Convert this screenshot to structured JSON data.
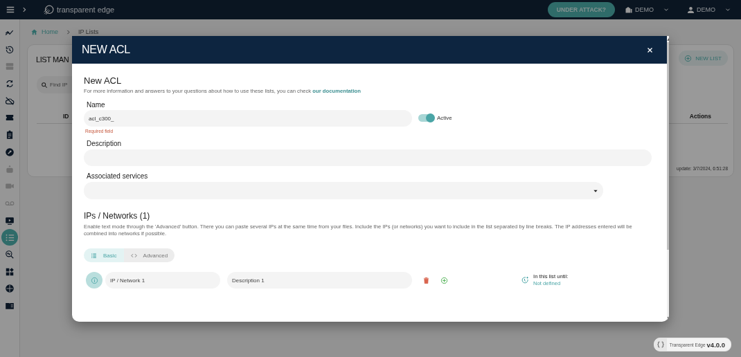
{
  "topbar": {
    "logo": "transparent edge",
    "attack_button": "UNDER ATTACK?",
    "company_menu": "DEMO",
    "user_menu": "DEMO"
  },
  "sidebar": {
    "items": [
      {
        "selected": false,
        "disabled": false
      },
      {
        "selected": false,
        "disabled": false
      },
      {
        "selected": false,
        "disabled": true
      },
      {
        "selected": false,
        "disabled": false
      },
      {
        "selected": false,
        "disabled": false
      },
      {
        "selected": false,
        "disabled": false
      },
      {
        "selected": false,
        "disabled": false
      },
      {
        "selected": false,
        "disabled": false
      },
      {
        "selected": false,
        "disabled": true
      },
      {
        "selected": false,
        "disabled": true
      },
      {
        "selected": false,
        "disabled": true
      },
      {
        "selected": false,
        "disabled": false
      },
      {
        "selected": true,
        "disabled": false
      },
      {
        "selected": false,
        "disabled": false
      },
      {
        "selected": false,
        "disabled": false
      },
      {
        "selected": false,
        "disabled": false
      },
      {
        "selected": false,
        "disabled": false
      }
    ]
  },
  "breadcrumb": [
    "Home",
    "IP Lists"
  ],
  "list_page": {
    "title": "LIST MAN",
    "search": {
      "placeholder": "Find IP"
    },
    "new_button": "NEW LIST",
    "columns": [
      "ID",
      "Actions"
    ],
    "last_update": "update: 3/7/2024, 6:51:28"
  },
  "modal": {
    "title": "NEW ACL",
    "heading": "New ACL",
    "intro": "For more information and answers to your questions about how to use these lists, you can check",
    "intro_link": "our documentation",
    "name": {
      "label": "Name",
      "value": "acl_c300_",
      "error": "Required field"
    },
    "active": {
      "label": "Active",
      "on": true
    },
    "description": {
      "label": "Description"
    },
    "services": {
      "label": "Associated services"
    },
    "networks": {
      "heading": "IPs / Networks (1)",
      "help": "Enable text mode through the 'Advanced' button. There you can paste several IPs at the same time from your files. Include the IPs (or networks) you want to include in the list separated by line breaks. The IP addresses entered will be combined into networks if possible.",
      "modes": [
        {
          "label": "Basic",
          "selected": true
        },
        {
          "label": "Advanced",
          "selected": false
        }
      ],
      "rows": [
        {
          "ip_placeholder": "IP / Network 1",
          "description_placeholder": "Description 1",
          "until_label": "In this list until:",
          "until_value": "Not defined"
        }
      ]
    }
  },
  "version": {
    "product": "Transparent Edge",
    "number": "v4.0.0"
  }
}
